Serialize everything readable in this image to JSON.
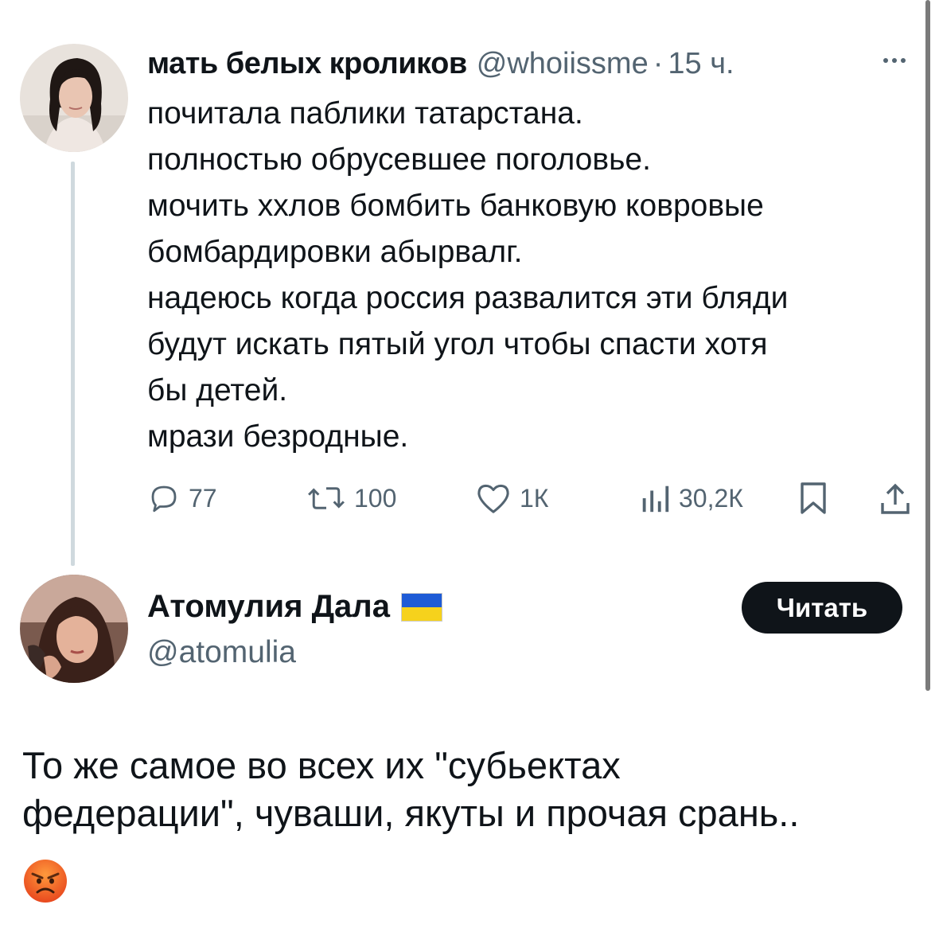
{
  "original_tweet": {
    "author_name": "мать белых кроликов",
    "handle": "@whoiissme",
    "separator": "·",
    "time": "15 ч.",
    "avatar_icon": "profile-photo",
    "body_lines": [
      "почитала паблики татарстана.",
      "полностью обрусевшее поголовье.",
      "мочить ххлов бомбить банковую ковровые",
      "бомбардировки абырвалг.",
      "надеюсь когда россия развалится эти бляди",
      "будут искать пятый угол чтобы спасти хотя",
      "бы детей.",
      "мрази безродные."
    ],
    "actions": {
      "replies": "77",
      "reposts": "100",
      "likes": "1К",
      "views": "30,2К"
    }
  },
  "reply_author": {
    "name": "Атомулия Дала",
    "handle": "@atomulia",
    "flag_colors": [
      "#1e5bd6",
      "#f6d21c"
    ],
    "follow_label": "Читать"
  },
  "reply": {
    "lines": [
      "То же самое во всех их \"субьектах",
      "федерации\", чуваши,  якуты и прочая срань.."
    ],
    "emoji": "angry-face"
  },
  "colors": {
    "text": "#0f1419",
    "secondary": "#536471",
    "thread_line": "#cfd9de",
    "button_bg": "#0f1419"
  }
}
